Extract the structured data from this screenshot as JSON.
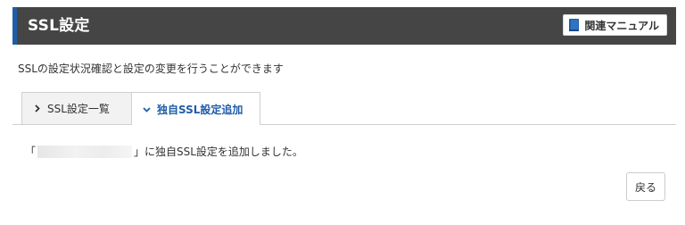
{
  "header": {
    "title": "SSL設定",
    "manual_button_label": "関連マニュアル",
    "manual_icon": "book-icon"
  },
  "description": "SSLの設定状況確認と設定の変更を行うことができます",
  "tabs": [
    {
      "label": "SSL設定一覧",
      "icon": "chevron-right-icon",
      "active": false
    },
    {
      "label": "独自SSL設定追加",
      "icon": "chevron-down-icon",
      "active": true
    }
  ],
  "message": {
    "open_bracket": "「",
    "close_suffix": "」に独自SSL設定を追加しました。"
  },
  "back_button_label": "戻る",
  "colors": {
    "header_bg": "#454545",
    "accent": "#1f5da8",
    "tab_inactive_bg": "#f2f2f2"
  }
}
